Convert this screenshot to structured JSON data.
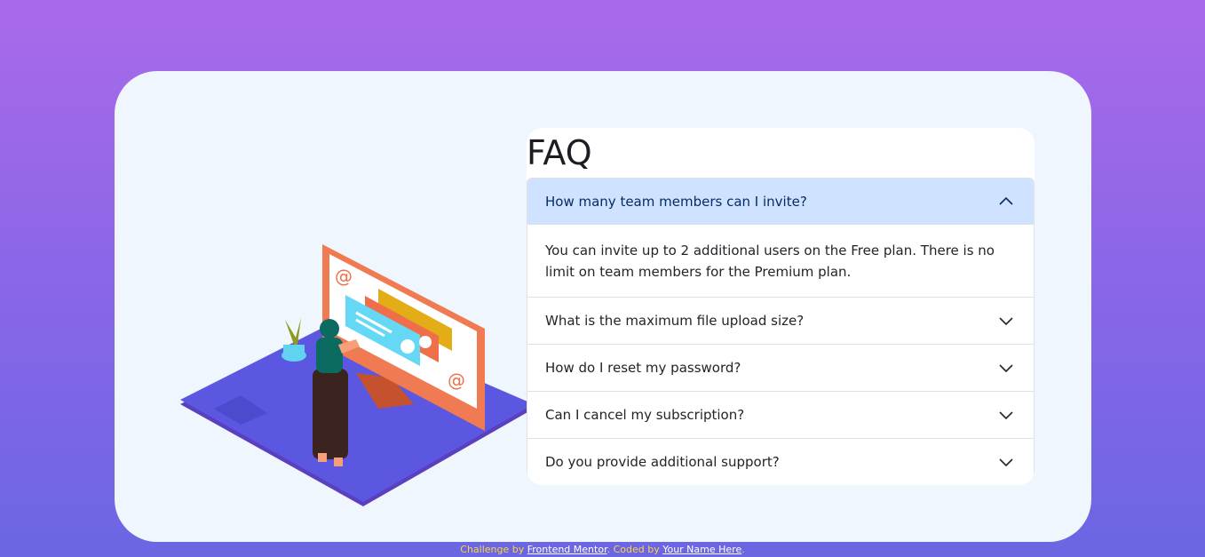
{
  "faq": {
    "title": "FAQ",
    "items": [
      {
        "question": "How many team members can I invite?",
        "answer": "You can invite up to 2 additional users on the Free plan. There is no limit on team members for the Premium plan.",
        "expanded": true
      },
      {
        "question": "What is the maximum file upload size?",
        "expanded": false
      },
      {
        "question": "How do I reset my password?",
        "expanded": false
      },
      {
        "question": "Can I cancel my subscription?",
        "expanded": false
      },
      {
        "question": "Do you provide additional support?",
        "expanded": false
      }
    ]
  },
  "attribution": {
    "prefix": "Challenge by ",
    "link1": "Frontend Mentor",
    "middle": ". Coded by ",
    "link2": "Your Name Here",
    "suffix": "."
  },
  "colors": {
    "bg_top": "#a96aea",
    "bg_bottom": "#6b66e2",
    "card": "#eff6fd",
    "active_header": "#cfe2ff",
    "attribution_text": "#f5d54a"
  },
  "icons": {
    "collapse": "chevron-up-icon",
    "expand": "chevron-down-icon"
  }
}
